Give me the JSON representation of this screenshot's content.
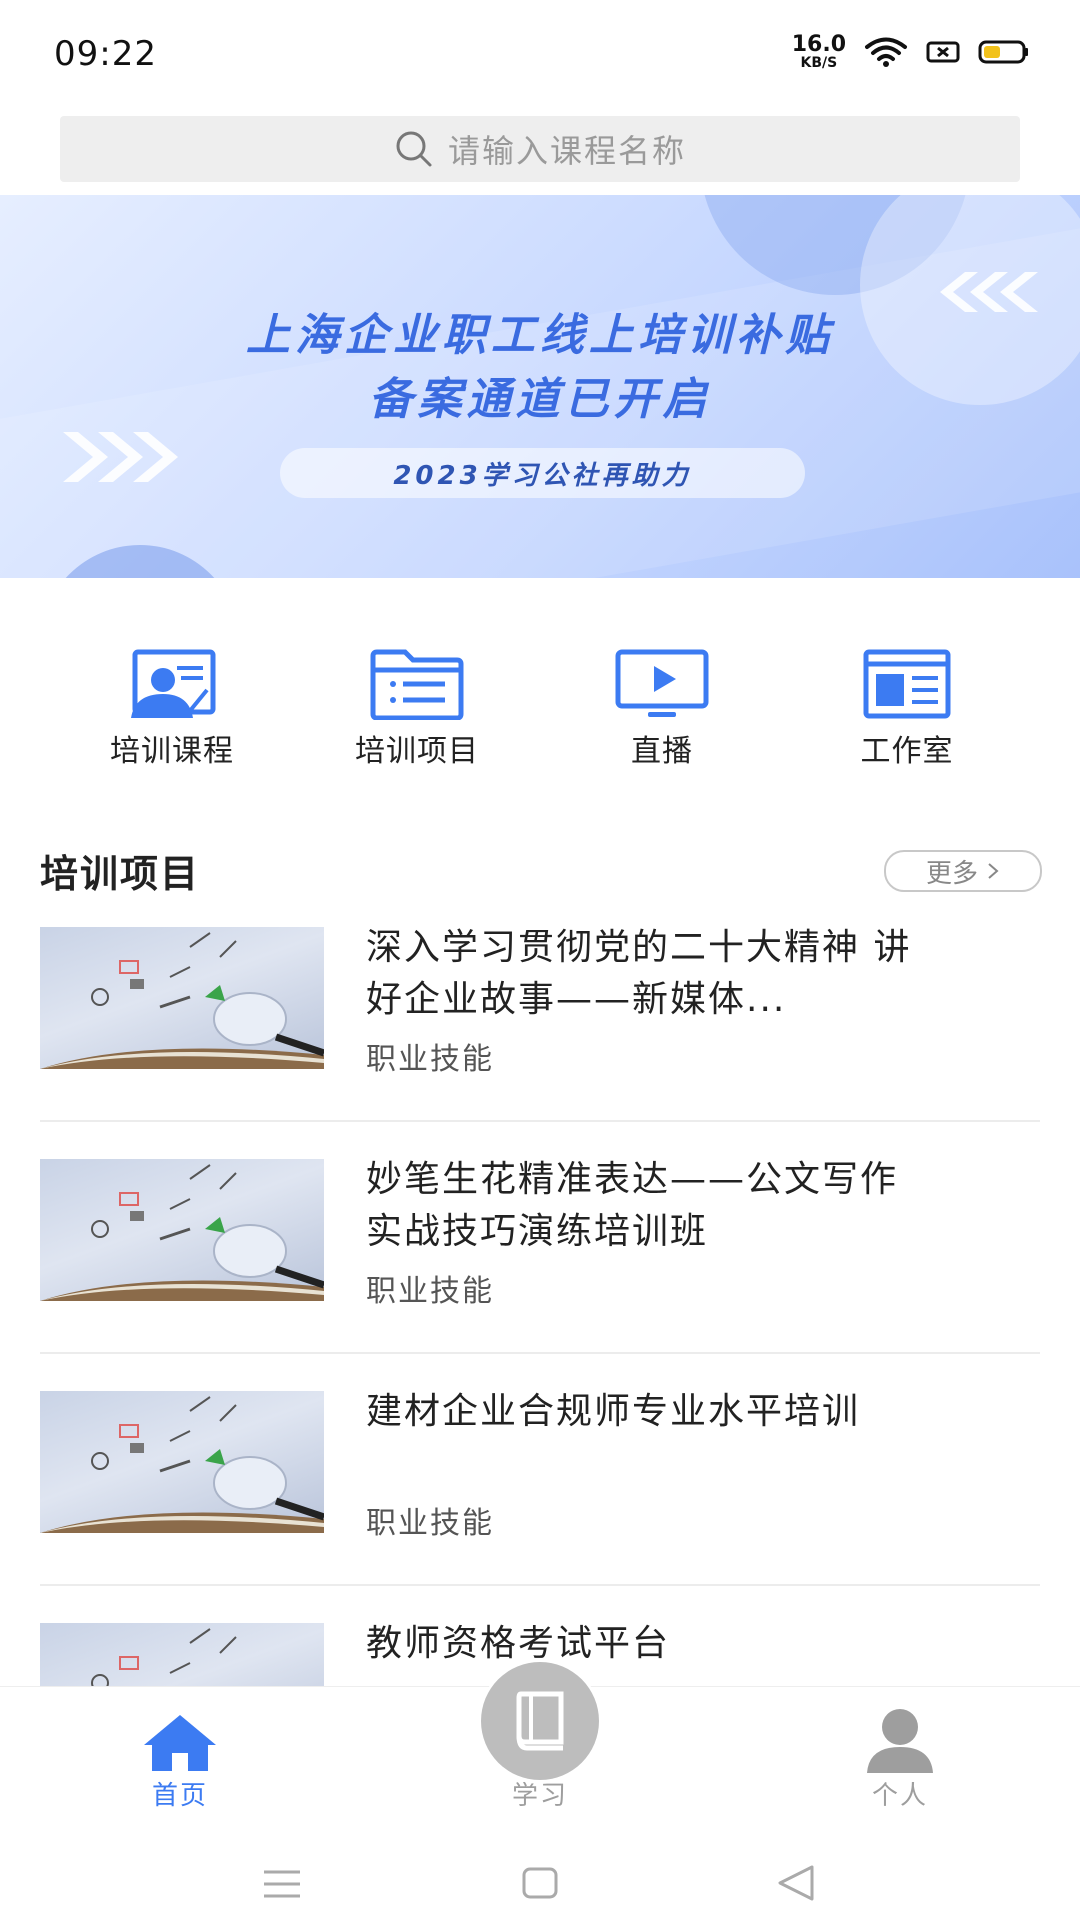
{
  "status_bar": {
    "time": "09:22",
    "net_speed": "16.0",
    "net_unit": "KB/S"
  },
  "search": {
    "placeholder": "请输入课程名称"
  },
  "banner": {
    "line1": "上海企业职工线上培训补贴",
    "line2": "备案通道已开启",
    "subtitle": "2023学习公社再助力"
  },
  "quick_nav": [
    {
      "label": "培训课程",
      "icon": "trainer-profile-icon"
    },
    {
      "label": "培训项目",
      "icon": "folder-list-icon"
    },
    {
      "label": "直播",
      "icon": "live-play-icon"
    },
    {
      "label": "工作室",
      "icon": "studio-newspaper-icon"
    }
  ],
  "section": {
    "title": "培训项目",
    "more_label": "更多"
  },
  "projects": [
    {
      "title": "深入学习贯彻党的二十大精神 讲好企业故事——新媒体...",
      "tag": "职业技能"
    },
    {
      "title": "妙笔生花精准表达——公文写作实战技巧演练培训班",
      "tag": "职业技能"
    },
    {
      "title": "建材企业合规师专业水平培训",
      "tag": "职业技能"
    },
    {
      "title": "教师资格考试平台",
      "tag": ""
    }
  ],
  "tabs": [
    {
      "label": "首页",
      "icon": "home-icon",
      "active": true
    },
    {
      "label": "学习",
      "icon": "book-icon",
      "active": false
    },
    {
      "label": "个人",
      "icon": "user-icon",
      "active": false
    }
  ],
  "colors": {
    "accent": "#3c7bf2",
    "inactive": "#9e9e9e",
    "banner_text": "#3a6be0"
  }
}
